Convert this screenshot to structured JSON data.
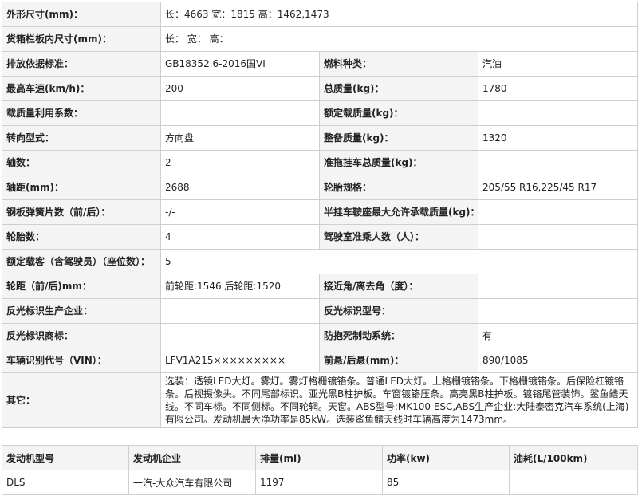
{
  "spec_rows": [
    {
      "type": "wide",
      "label": "外形尺寸(mm)：",
      "value": "长：4663 宽：1815 高：1462,1473"
    },
    {
      "type": "wide",
      "label": "货箱栏板内尺寸(mm)：",
      "value": "长： 宽： 高："
    },
    {
      "type": "pair",
      "label1": "排放依据标准：",
      "value1": "GB18352.6-2016国VI",
      "label2": "燃料种类：",
      "value2": "汽油"
    },
    {
      "type": "pair",
      "label1": "最高车速(km/h)：",
      "value1": "200",
      "label2": "总质量(kg)：",
      "value2": "1780"
    },
    {
      "type": "pair",
      "label1": "载质量利用系数：",
      "value1": "",
      "label2": "额定载质量(kg)：",
      "value2": ""
    },
    {
      "type": "pair",
      "label1": "转向型式：",
      "value1": "方向盘",
      "label2": "整备质量(kg)：",
      "value2": "1320"
    },
    {
      "type": "pair",
      "label1": "轴数：",
      "value1": "2",
      "label2": "准拖挂车总质量(kg)：",
      "value2": ""
    },
    {
      "type": "pair",
      "label1": "轴距(mm)：",
      "value1": "2688",
      "label2": "轮胎规格：",
      "value2": "205/55 R16,225/45 R17"
    },
    {
      "type": "pair",
      "label1": "钢板弹簧片数（前/后）：",
      "value1": "-/-",
      "label2": "半挂车鞍座最大允许承载质量(kg)：",
      "value2": ""
    },
    {
      "type": "pair",
      "label1": "轮胎数：",
      "value1": "4",
      "label2": "驾驶室准乘人数（人）：",
      "value2": ""
    },
    {
      "type": "wide",
      "label": "额定载客（含驾驶员）（座位数）：",
      "value": "5"
    },
    {
      "type": "pair",
      "label1": "轮距（前/后)mm：",
      "value1": "前轮距:1546 后轮距:1520",
      "label2": "接近角/离去角（度）：",
      "value2": ""
    },
    {
      "type": "pair",
      "label1": "反光标识生产企业：",
      "value1": "",
      "label2": "反光标识型号：",
      "value2": ""
    },
    {
      "type": "pair",
      "label1": "反光标识商标：",
      "value1": "",
      "label2": "防抱死制动系统：",
      "value2": "有"
    },
    {
      "type": "pair",
      "label1": "车辆识别代号（VIN）：",
      "value1": "LFV1A215×××××××××",
      "label2": "前悬/后悬(mm)：",
      "value2": "890/1085"
    },
    {
      "type": "other",
      "label": "其它：",
      "value": "选装：透镜LED大灯。雾灯。雾灯格栅镀铬条。普通LED大灯。上格栅镀铬条。下格栅镀铬条。后保险杠镀铬条。后视摄像头。不同尾部标识。亚光黑B柱护板。车窗镀铬压条。高亮黑B柱护板。镀铬尾管装饰。鲨鱼鳍天线。不同车标。不同侧标。不同轮辋。天窗。ABS型号:MK100 ESC,ABS生产企业:大陆泰密克汽车系统(上海)有限公司。发动机最大净功率是85kW。选装鲨鱼鳍天线时车辆高度为1473mm。"
    }
  ],
  "engine_table": {
    "headers": [
      "发动机型号",
      "发动机企业",
      "排量(ml)",
      "功率(kw)",
      "油耗(L/100km)"
    ],
    "rows": [
      [
        "DLS",
        "一汽-大众汽车有限公司",
        "1197",
        "85",
        ""
      ]
    ]
  }
}
